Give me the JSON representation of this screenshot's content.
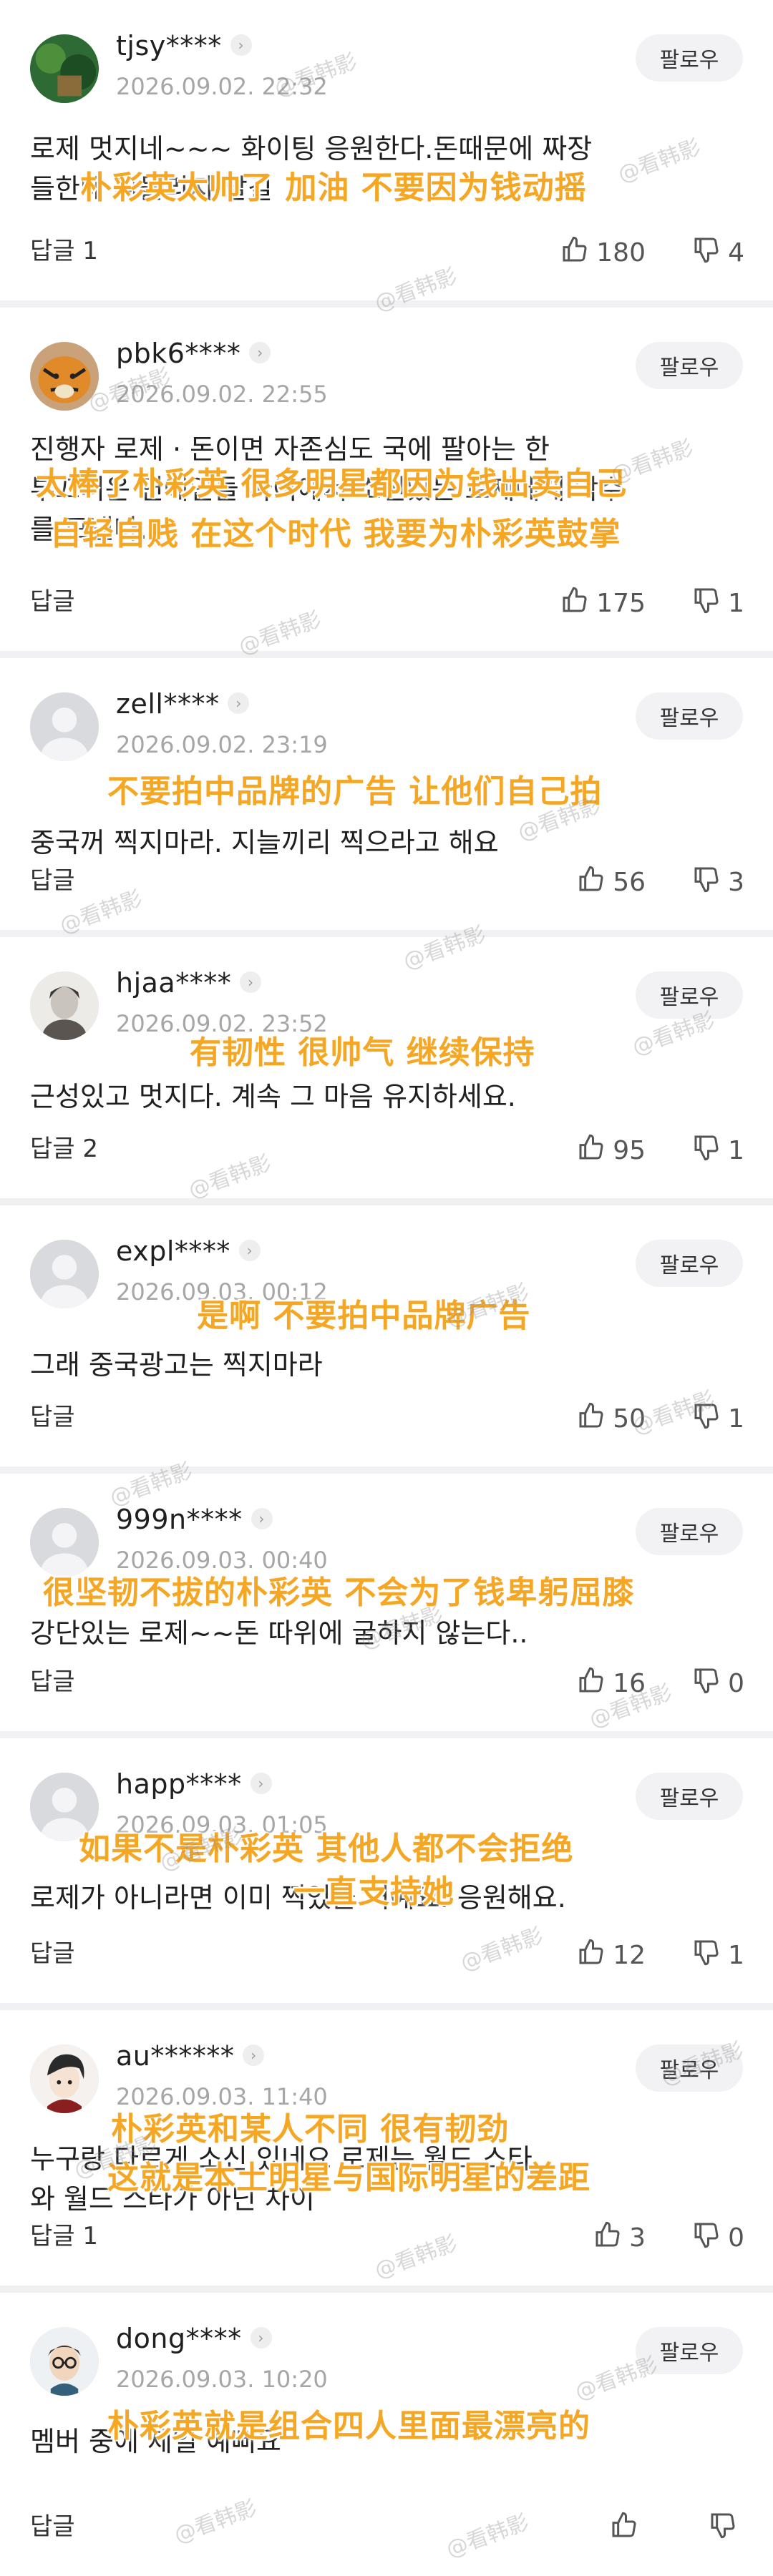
{
  "follow_label": "팔로우",
  "watermark_text": "@看韩影",
  "comments": [
    {
      "username": "tjsy****",
      "date": "2026.09.02. 22:32",
      "text": "로제 멋지네~~~ 화이팅 응원한다.돈때문에 짜장\n들한테 휘둘리지 말길",
      "overlay": [
        "朴彩英太帅了 加油 不要因为钱动摇"
      ],
      "reply": "답글 1",
      "likes": "180",
      "dislikes": "4",
      "avatar": "photo-green"
    },
    {
      "username": "pbk6****",
      "date": "2026.09.02. 22:55",
      "text": "진행자 로제 · 돈이면 자존심도 국에 팔아는 한\n부끄러운 연예인들 사이에서 소신있는 로제에게 박수\n를 모낸나...",
      "overlay": [
        "太棒了朴彩英 很多明星都因为钱出卖自己",
        "自轻自贱 在这个时代 我要为朴彩英鼓掌"
      ],
      "reply": "답글",
      "likes": "175",
      "dislikes": "1",
      "avatar": "tiger"
    },
    {
      "username": "zell****",
      "date": "2026.09.02. 23:19",
      "text": "중국꺼 찍지마라. 지늘끼리 찍으라고 해요",
      "overlay": [
        "不要拍中品牌的广告 让他们自己拍"
      ],
      "reply": "답글",
      "likes": "56",
      "dislikes": "3",
      "avatar": "default"
    },
    {
      "username": "hjaa****",
      "date": "2026.09.02. 23:52",
      "text": "근성있고 멋지다. 계속 그 마음 유지하세요.",
      "overlay": [
        "有韧性 很帅气 继续保持"
      ],
      "reply": "답글 2",
      "likes": "95",
      "dislikes": "1",
      "avatar": "portrait"
    },
    {
      "username": "expl****",
      "date": "2026.09.03. 00:12",
      "text": "그래 중국광고는 찍지마라",
      "overlay": [
        "是啊 不要拍中品牌广告"
      ],
      "reply": "답글",
      "likes": "50",
      "dislikes": "1",
      "avatar": "default"
    },
    {
      "username": "999n****",
      "date": "2026.09.03. 00:40",
      "text": "강단있는 로제~~돈 따위에 굴하지 않는다..",
      "overlay": [
        "很坚韧不拔的朴彩英 不会为了钱卑躬屈膝"
      ],
      "reply": "답글",
      "likes": "16",
      "dislikes": "0",
      "avatar": "default"
    },
    {
      "username": "happ****",
      "date": "2026.09.03. 01:05",
      "text": "로제가 아니라면 이미 찍었을 거예요. 응원해요.",
      "overlay": [
        "如果不是朴彩英 其他人都不会拒绝",
        "一直支持她"
      ],
      "reply": "답글",
      "likes": "12",
      "dislikes": "1",
      "avatar": "default"
    },
    {
      "username": "au******",
      "date": "2026.09.03. 11:40",
      "text": "누구랑 다르게 소신 있네요 로제는 월드 스타\n와 월드 스타가 아닌 차이",
      "overlay": [
        "朴彩英和某人不同 很有韧劲",
        "这就是本土明星与国际明星的差距"
      ],
      "reply": "답글 1",
      "likes": "3",
      "dislikes": "0",
      "avatar": "cartoon"
    },
    {
      "username": "dong****",
      "date": "2026.09.03. 10:20",
      "text": "멤버 중에 제일 예뻐요",
      "overlay": [
        "朴彩英就是组合四人里面最漂亮的"
      ],
      "reply": "답글",
      "likes": "",
      "dislikes": "",
      "avatar": "glasses"
    }
  ]
}
